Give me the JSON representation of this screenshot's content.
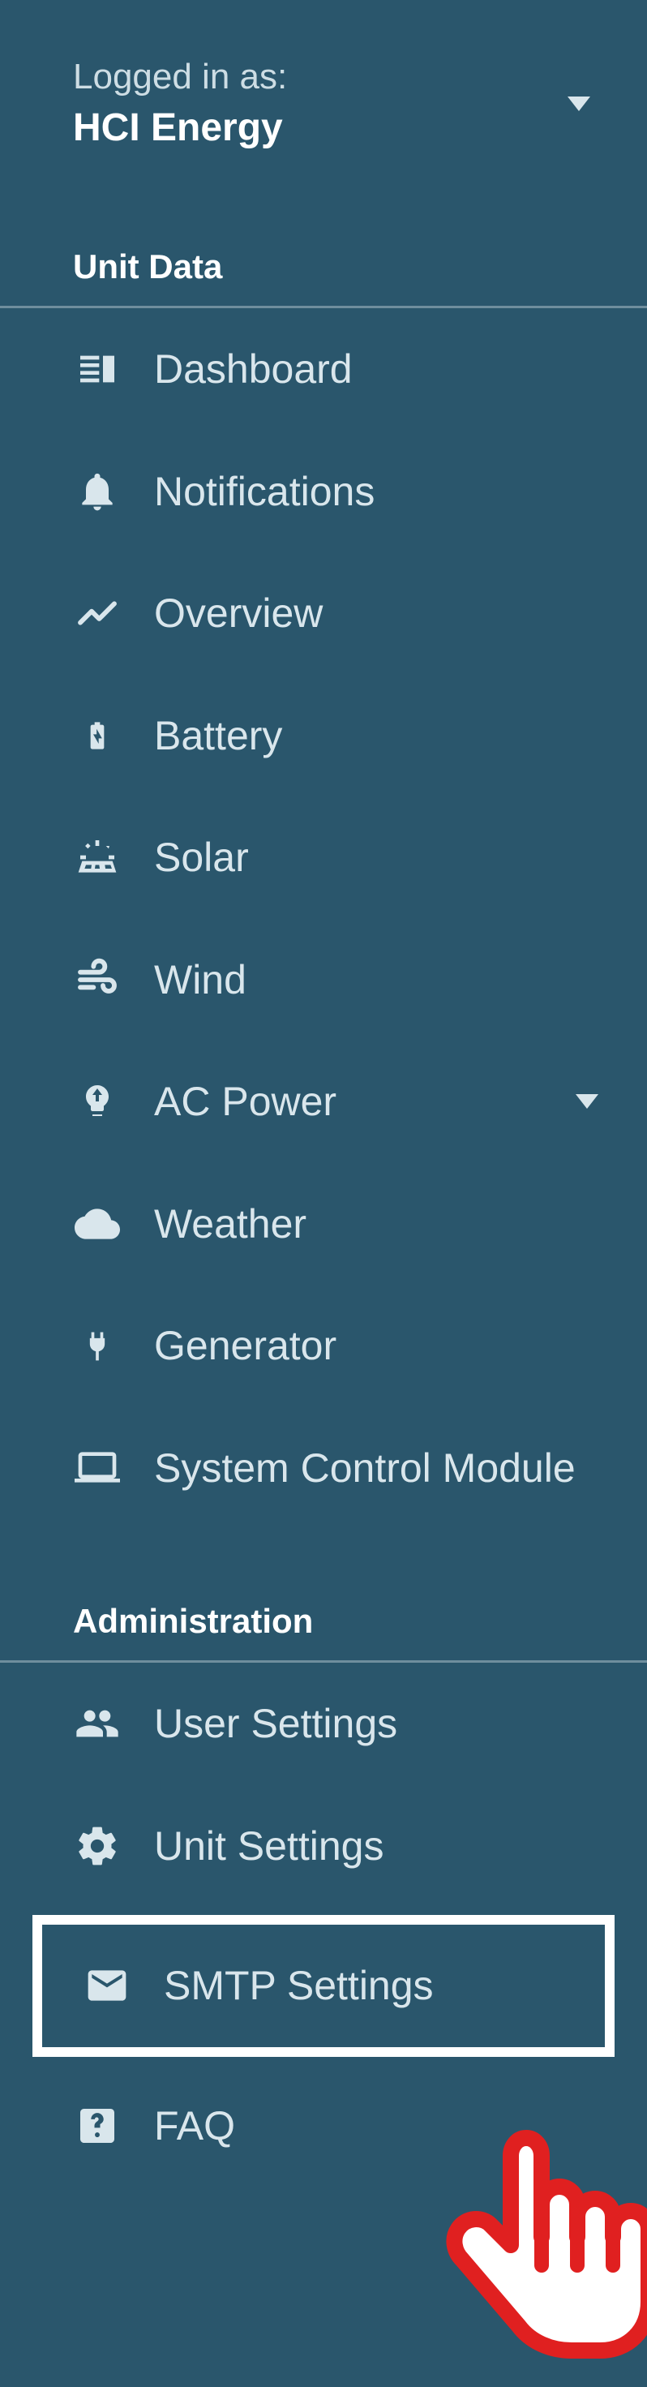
{
  "account": {
    "logged_in_label": "Logged in as:",
    "org_name": "HCI Energy"
  },
  "sections": {
    "unit_data": "Unit Data",
    "administration": "Administration"
  },
  "nav": {
    "dashboard": "Dashboard",
    "notifications": "Notifications",
    "overview": "Overview",
    "battery": "Battery",
    "solar": "Solar",
    "wind": "Wind",
    "ac_power": "AC Power",
    "weather": "Weather",
    "generator": "Generator",
    "scm": "System Control Module",
    "user_settings": "User Settings",
    "unit_settings": "Unit Settings",
    "smtp_settings": "SMTP Settings",
    "faq": "FAQ"
  },
  "colors": {
    "bg": "#2a566c",
    "text": "#d9e6ec",
    "highlight": "#ffffff",
    "cursor": "#e02020"
  }
}
